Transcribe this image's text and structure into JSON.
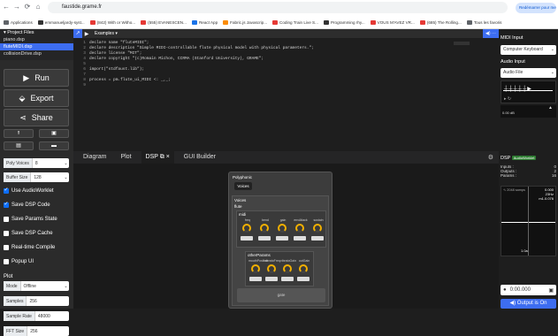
{
  "browser": {
    "url": "faustide.grame.fr",
    "relaunch_label": "Redémarrer pour mettre à jour ⋮",
    "bookmarks": [
      {
        "label": "Applications",
        "color": "#5f6368"
      },
      {
        "label": "emmanueljardy-syst...",
        "color": "#333"
      },
      {
        "label": "(842) With or Witho...",
        "color": "#e53935"
      },
      {
        "label": "(555) EVANESCEN...",
        "color": "#e53935"
      },
      {
        "label": "React App",
        "color": "#1a73e8"
      },
      {
        "label": "Fabric.js Javascrip...",
        "color": "#fb8c00"
      },
      {
        "label": "Coding Train Live S...",
        "color": "#e53935"
      },
      {
        "label": "Programming rhy...",
        "color": "#333"
      },
      {
        "label": "VOUS M'AVEZ VR...",
        "color": "#e53935"
      },
      {
        "label": "(685) The Rolling...",
        "color": "#e53935"
      },
      {
        "label": "Tous les favoris",
        "color": "#5f6368"
      }
    ]
  },
  "left": {
    "project_files_label": "Project Files",
    "files": [
      "piano.dsp",
      "fluteMIDI.dsp",
      "collisionDrive.dsp"
    ],
    "selected_file_index": 1,
    "run_label": "Run",
    "export_label": "Export",
    "share_label": "Share",
    "poly_voices": {
      "label": "Poly Voices",
      "value": "8"
    },
    "buffer_size": {
      "label": "Buffer Size",
      "value": "128"
    },
    "options": [
      {
        "label": "Use AudioWorklet",
        "checked": true
      },
      {
        "label": "Save DSP Code",
        "checked": true
      },
      {
        "label": "Save Params State",
        "checked": false
      },
      {
        "label": "Save DSP Cache",
        "checked": false
      },
      {
        "label": "Real-time Compile",
        "checked": false
      },
      {
        "label": "Popup UI",
        "checked": false
      }
    ],
    "plot_label": "Plot",
    "mode": {
      "label": "Mode",
      "value": "Offline"
    },
    "samples": {
      "label": "Samples",
      "value": "256"
    },
    "sample_rate": {
      "label": "Sample Rate",
      "value": "48000"
    },
    "fft_size": {
      "label": "FFT Size",
      "value": "256"
    }
  },
  "editor": {
    "examples_label": "Examples",
    "lines": [
      "declare name \"fluteMIDI\";",
      "declare description \"Simple MIDI-controllable flute physical model with physical parameters.\";",
      "declare license \"MIT\";",
      "declare copyright \"(c)Romain Michon, CCRMA (Stanford University), GRAME\";",
      "",
      "import(\"stdfaust.lib\");",
      "",
      "process = pm.flute_ui_MIDI <: _,_;",
      ""
    ]
  },
  "tabs": [
    "Diagram",
    "Plot",
    "DSP",
    "GUI Builder"
  ],
  "active_tab": "DSP",
  "dsp_ui": {
    "polyphonic": "Polyphonic",
    "voices_button": "Voices",
    "voices_section": "Voices",
    "flute": "flute",
    "midi": "midi",
    "midi_knobs": [
      "freq",
      "bend",
      "gain",
      "envAttack",
      "sustain"
    ],
    "other_params": "otherParams",
    "other_knobs": [
      "mouthPosition",
      "vibratoFreq",
      "vibratoGain",
      "outGain"
    ],
    "gate": "gate"
  },
  "right": {
    "midi_input_label": "MIDI Input",
    "midi_input_value": "Computer Keyboard",
    "audio_input_label": "Audio Input",
    "audio_input_value": "Audio File",
    "meter_value": "0.00 dB",
    "dsp_label": "DSP",
    "audioworklet_badge": "AudioWorklet",
    "inputs_label": "Inputs :",
    "inputs_value": "0",
    "outputs_label": "Outputs :",
    "outputs_value": "2",
    "params_label": "Params :",
    "params_value": "16",
    "scope_samples": "2048 samps",
    "scope_value1": "0.000",
    "scope_value2": "23Hz",
    "scope_value3": "m1.0.076",
    "scope_bottom": "1.0a",
    "time": "0:00.000",
    "output_label": "Output is On"
  }
}
